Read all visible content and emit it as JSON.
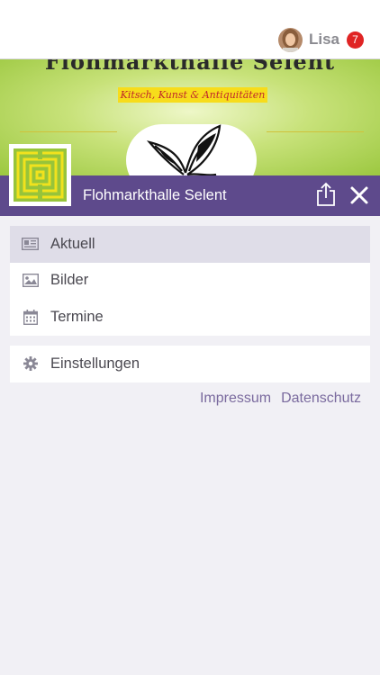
{
  "user": {
    "name": "Lisa",
    "notification_count": "7"
  },
  "banner": {
    "title": "Flohmarkthalle Selent",
    "slogan": "Kitsch, Kunst & Antiquitäten"
  },
  "header": {
    "title": "Flohmarkthalle Selent"
  },
  "menu_primary": [
    {
      "label": "Aktuell",
      "icon": "newspaper-icon",
      "active": true
    },
    {
      "label": "Bilder",
      "icon": "image-icon",
      "active": false
    },
    {
      "label": "Termine",
      "icon": "calendar-icon",
      "active": false
    }
  ],
  "menu_secondary": [
    {
      "label": "Einstellungen",
      "icon": "gear-icon"
    }
  ],
  "footer": {
    "impressum": "Impressum",
    "datenschutz": "Datenschutz"
  },
  "colors": {
    "header": "#5e4a8c",
    "badge": "#e02424",
    "accent_text": "#7a6a9e"
  }
}
